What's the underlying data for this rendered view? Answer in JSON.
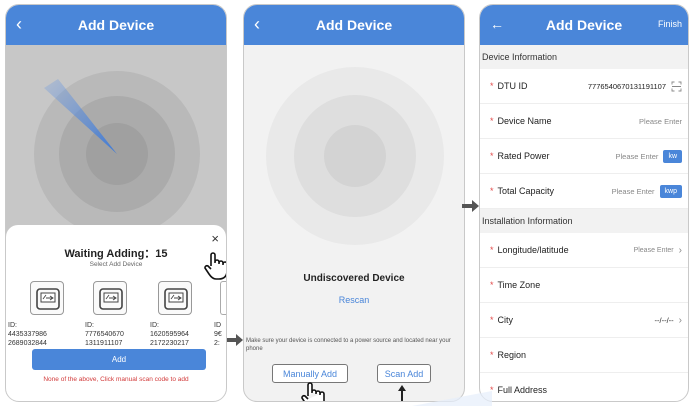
{
  "panel1": {
    "header_title": "Add Device",
    "back_glyph": "‹",
    "close_glyph": "×",
    "waiting_title": "Waiting Adding：15",
    "select_label": "Select Add Device",
    "devices": [
      {
        "line1": "ID:",
        "line2": "4435337986",
        "line3": "2689032844"
      },
      {
        "line1": "ID:",
        "line2": "7776540670",
        "line3": "1311911107"
      },
      {
        "line1": "ID:",
        "line2": "1620595964",
        "line3": "2172230217"
      },
      {
        "line1": "ID",
        "line2": "9€",
        "line3": "2:"
      }
    ],
    "add_button": "Add",
    "manual_note": "None of the above, Click manual scan code to add"
  },
  "panel2": {
    "header_title": "Add Device",
    "back_glyph": "‹",
    "undiscovered": "Undiscovered Device",
    "rescan": "Rescan",
    "hint": "Make sure your device is connected to a power source and located near your phone",
    "manual_add": "Manually Add",
    "scan_add": "Scan Add"
  },
  "panel3": {
    "header_title": "Add Device",
    "back_glyph": "←",
    "finish": "Finish",
    "section_device": "Device Information",
    "section_install": "Installation Information",
    "star": "*",
    "fields": {
      "dtu_id": {
        "label": "DTU ID",
        "value": "7776540670131191107"
      },
      "device_name": {
        "label": "Device Name",
        "placeholder": "Please Enter"
      },
      "rated_power": {
        "label": "Rated Power",
        "placeholder": "Please Enter",
        "unit": "kw"
      },
      "total_capacity": {
        "label": "Total Capacity",
        "placeholder": "Please Enter",
        "unit": "kwp"
      },
      "longitude": {
        "label": "Longitude/latitude",
        "placeholder": "Please Enter",
        "chevron": "›"
      },
      "time_zone": {
        "label": "Time Zone"
      },
      "city": {
        "label": "City",
        "value": "--/--/--",
        "chevron": "›"
      },
      "region": {
        "label": "Region"
      },
      "full_address": {
        "label": "Full Address"
      }
    }
  },
  "colors": {
    "accent": "#4a86d9",
    "radar_gray": "#c7c7c7",
    "required_red": "#e24a4a"
  }
}
